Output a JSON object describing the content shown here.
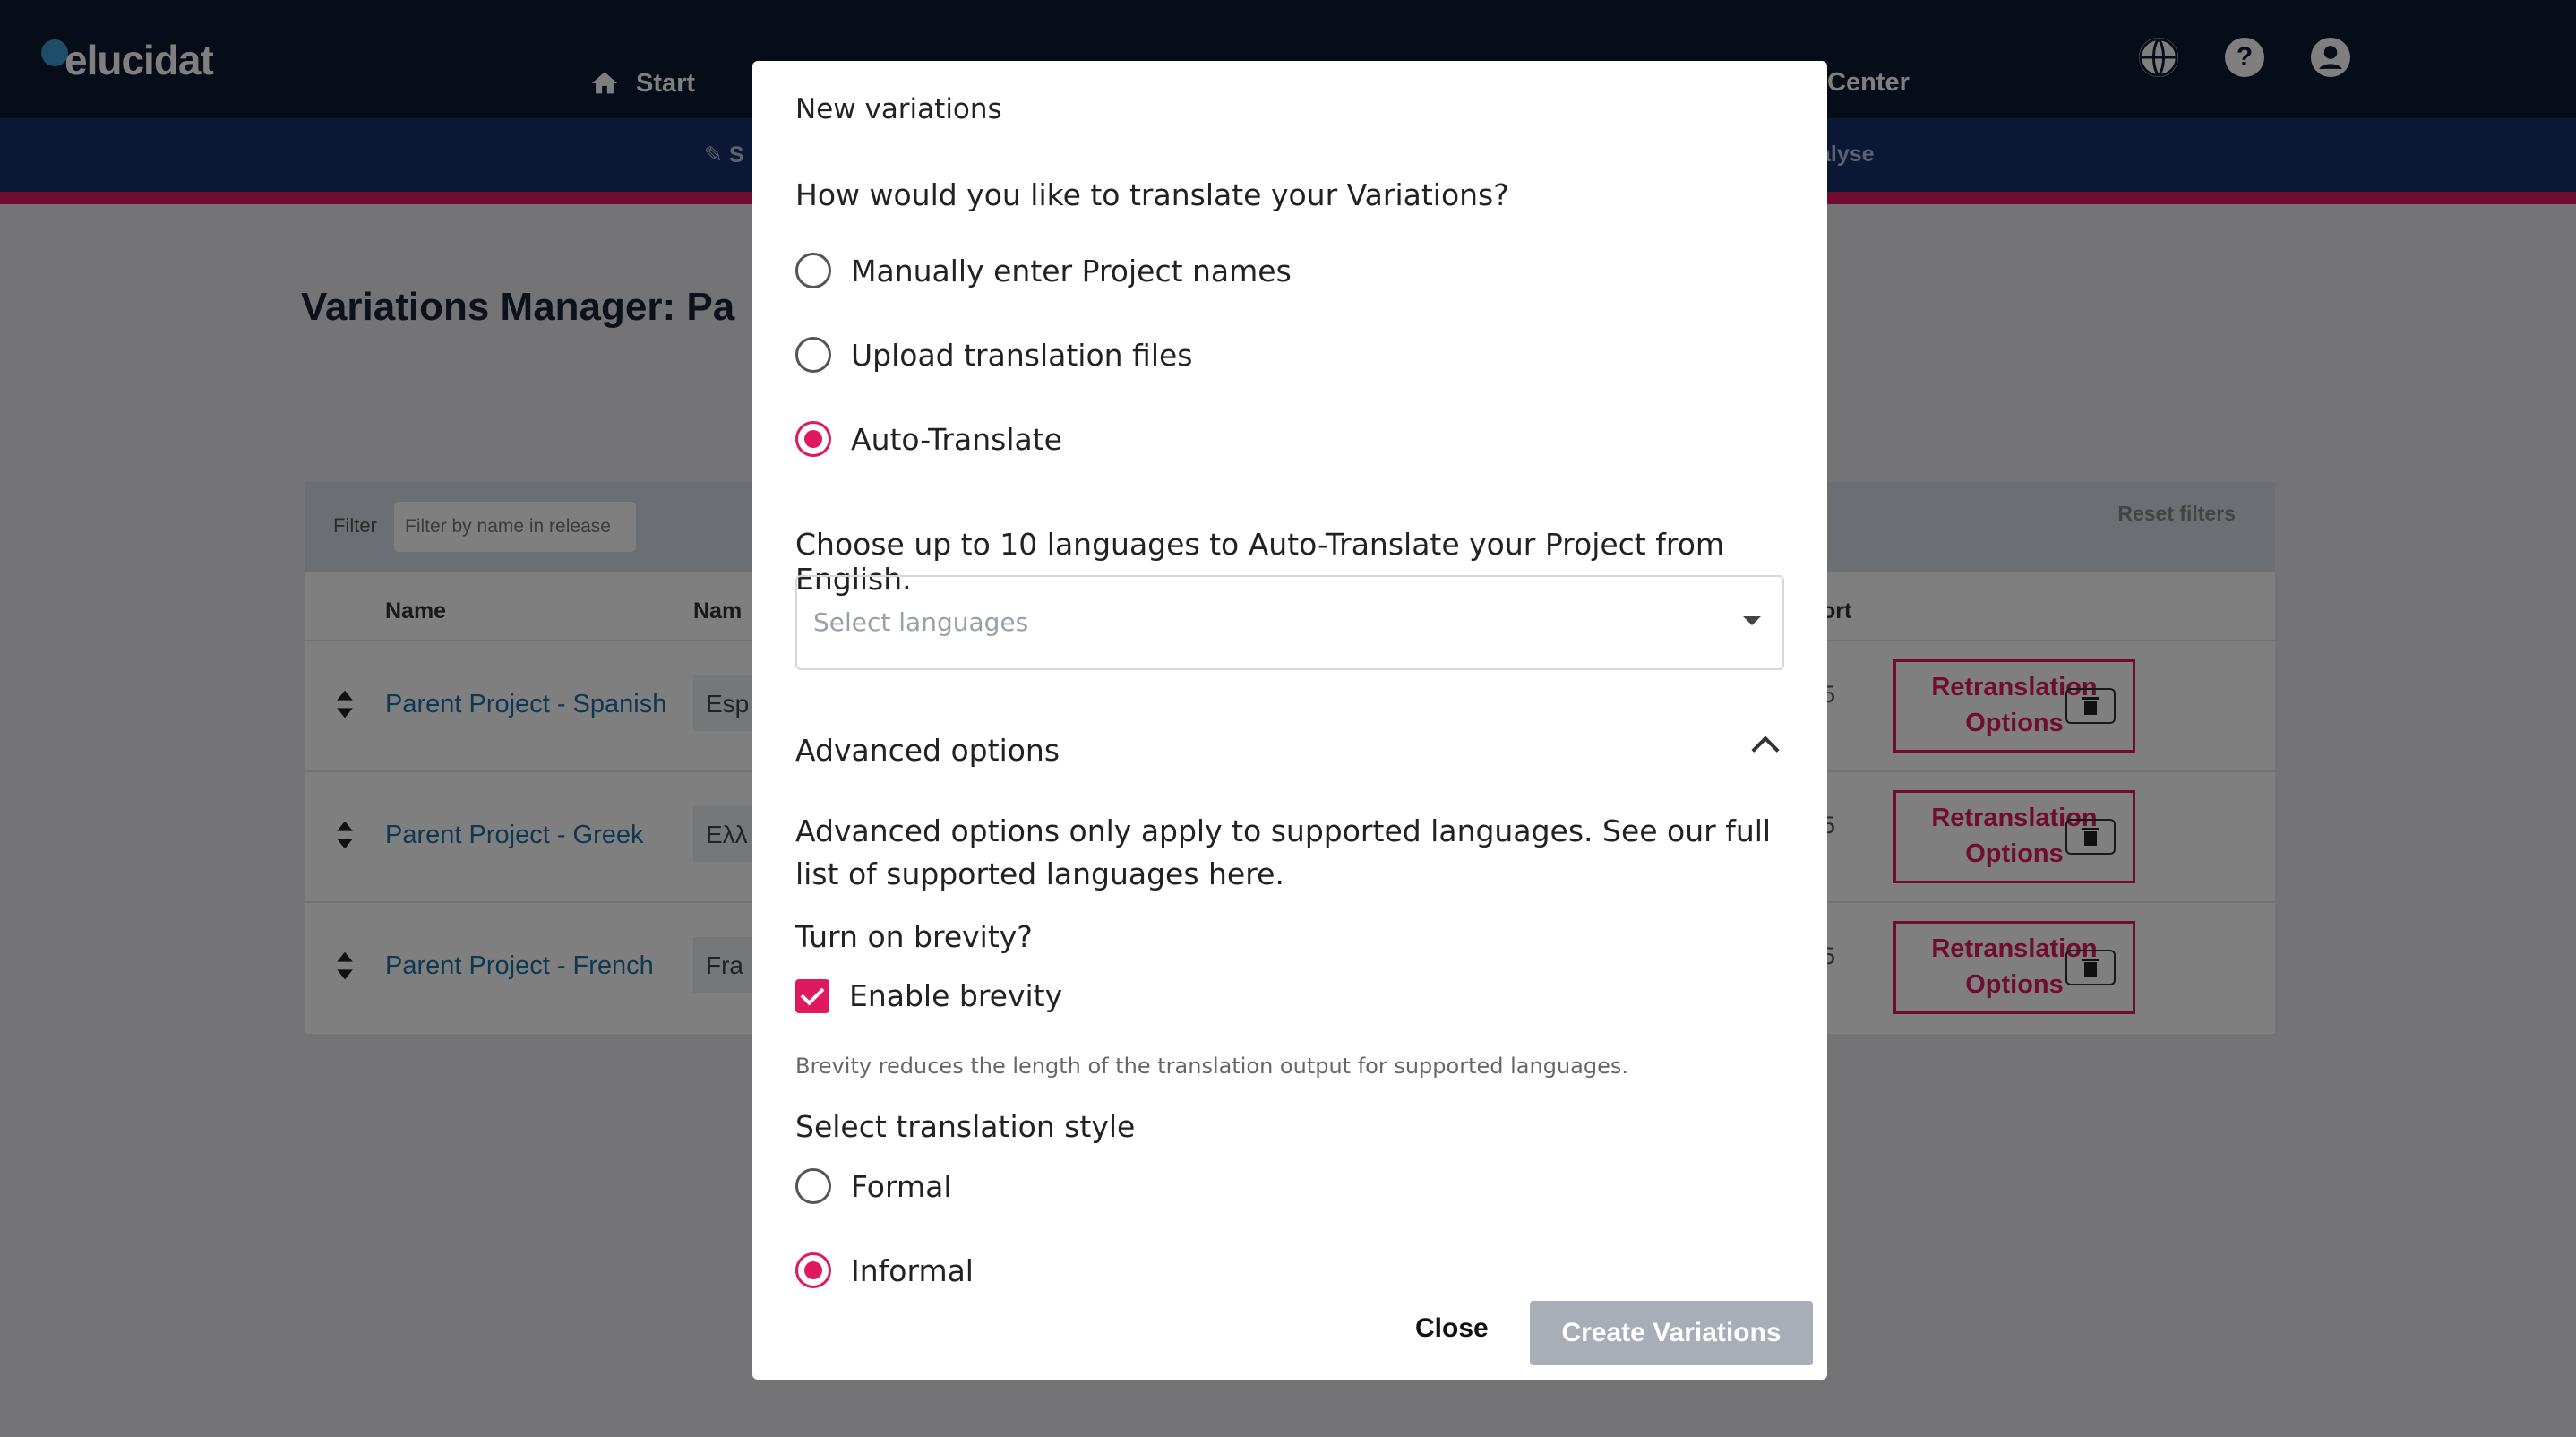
{
  "app": {
    "logo_text": "elucidat"
  },
  "nav": {
    "start_label": "Start",
    "center_label": "Center",
    "subnav_partial": "S",
    "analyse_partial": "alyse"
  },
  "page": {
    "title_partial": "Variations Manager: Pa"
  },
  "filters": {
    "label": "Filter",
    "placeholder": "Filter by name in release",
    "reset_label": "Reset filters"
  },
  "table": {
    "columns": {
      "name": "Name",
      "name2_partial": "Nam",
      "sort_partial": "ort"
    },
    "rows": [
      {
        "name": "Parent Project - Spanish",
        "value_partial": "Esp",
        "num_partial": "5",
        "retranslation": "Retranslation Options"
      },
      {
        "name": "Parent Project - Greek",
        "value_partial": "Ελλ",
        "num_partial": "5",
        "retranslation": "Retranslation Options"
      },
      {
        "name": "Parent Project - French",
        "value_partial": "Fra",
        "num_partial": "5",
        "retranslation": "Retranslation Options"
      }
    ]
  },
  "modal": {
    "title": "New variations",
    "question": "How would you like to translate your Variations?",
    "methods": [
      {
        "label": "Manually enter Project names",
        "selected": false
      },
      {
        "label": "Upload translation files",
        "selected": false
      },
      {
        "label": "Auto-Translate",
        "selected": true
      }
    ],
    "choose_languages": "Choose up to 10 languages to Auto-Translate your Project from English.",
    "languages_placeholder": "Select languages",
    "advanced": {
      "title": "Advanced options",
      "expanded": true,
      "description": "Advanced options only apply to supported languages. See our full list of supported languages here.",
      "brevity_question": "Turn on brevity?",
      "brevity_label": "Enable brevity",
      "brevity_checked": true,
      "brevity_help": "Brevity reduces the length of the translation output for supported languages.",
      "style_title": "Select translation style",
      "styles": [
        {
          "label": "Formal",
          "selected": false
        },
        {
          "label": "Informal",
          "selected": true
        }
      ]
    },
    "close_label": "Close",
    "create_label": "Create Variations"
  },
  "colors": {
    "accent": "#e0195f",
    "nav_bg": "#0c1a33",
    "subnav_bg": "#14306b",
    "link": "#1d6fa5",
    "disabled_button": "#a8adb8"
  },
  "icons": [
    "home-icon",
    "pencil-icon",
    "globe-icon",
    "help-icon",
    "account-icon",
    "sort-icon",
    "trash-icon",
    "chevron-up-icon",
    "caret-down-icon",
    "check-icon"
  ]
}
